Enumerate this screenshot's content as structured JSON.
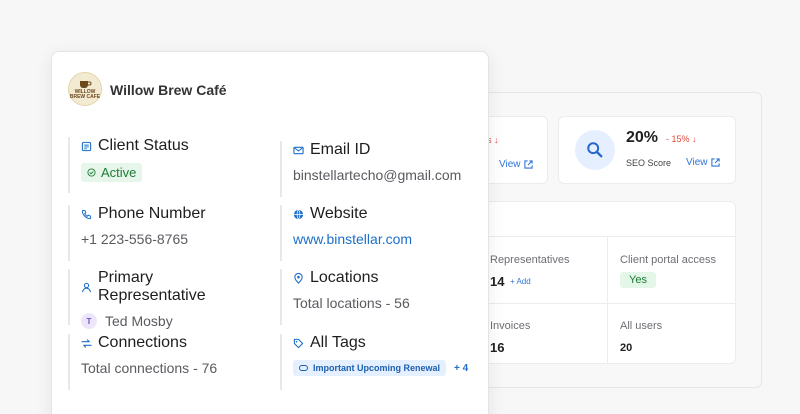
{
  "client": {
    "logo_text": "WILLOW BREW CAFE",
    "name": "Willow Brew Café",
    "fields": {
      "status": {
        "title": "Client Status",
        "value": "Active",
        "color": "#1f7a35"
      },
      "email": {
        "title": "Email ID",
        "value": "binstellartecho@gmail.com"
      },
      "phone": {
        "title": "Phone Number",
        "value": "+1 223-556-8765"
      },
      "website": {
        "title": "Website",
        "value": "www.binstellar.com"
      },
      "representative": {
        "title": "Primary Representative",
        "avatar_initial": "T",
        "value": "Ted Mosby"
      },
      "locations": {
        "title": "Locations",
        "value": "Total locations - 56"
      },
      "connections": {
        "title": "Connections",
        "value": "Total connections - 76"
      },
      "tags": {
        "title": "All Tags",
        "tag": "Important Upcoming Renewal",
        "more": "+ 4"
      }
    }
  },
  "dashboard": {
    "card1": {
      "trend": "s ↓",
      "view": "View"
    },
    "seo": {
      "value": "20%",
      "trend": "- 15% ↓",
      "label": "SEO Score",
      "view": "View"
    },
    "stats": {
      "representatives": {
        "label": "Representatives",
        "value": "14",
        "add": "+ Add"
      },
      "client_portal": {
        "label": "Client portal access",
        "value": "Yes"
      },
      "invoices": {
        "label": "Invoices",
        "value": "16"
      },
      "all_users": {
        "label": "All users",
        "value": "20"
      }
    }
  },
  "colors": {
    "accent": "#1d6fc9",
    "trend_down": "#e0493b",
    "success": "#1f7a35"
  }
}
